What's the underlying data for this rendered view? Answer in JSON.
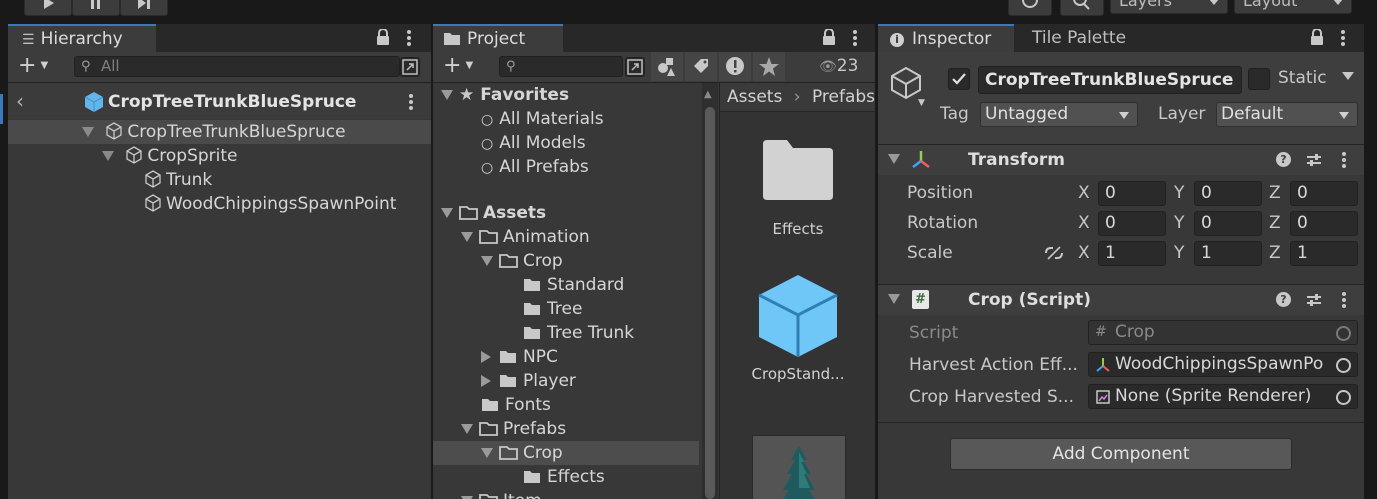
{
  "toolbar": {
    "layers_label": "Layers",
    "layout_label": "Layout"
  },
  "hierarchy": {
    "tab_label": "Hierarchy",
    "search_placeholder": "All",
    "prefab_title": "CropTreeTrunkBlueSpruce",
    "items": [
      {
        "label": "CropTreeTrunkBlueSpruce"
      },
      {
        "label": "CropSprite"
      },
      {
        "label": "Trunk"
      },
      {
        "label": "WoodChippingsSpawnPoint"
      }
    ]
  },
  "project": {
    "tab_label": "Project",
    "hidden_count": "23",
    "breadcrumb": [
      "Assets",
      "Prefabs"
    ],
    "favorites_label": "Favorites",
    "favorites": [
      "All Materials",
      "All Models",
      "All Prefabs"
    ],
    "assets_label": "Assets",
    "tree": [
      {
        "label": "Animation"
      },
      {
        "label": "Crop"
      },
      {
        "label": "Standard"
      },
      {
        "label": "Tree"
      },
      {
        "label": "Tree Trunk"
      },
      {
        "label": "NPC"
      },
      {
        "label": "Player"
      },
      {
        "label": "Fonts"
      },
      {
        "label": "Prefabs"
      },
      {
        "label": "Crop"
      },
      {
        "label": "Effects"
      },
      {
        "label": "Item"
      }
    ],
    "grid_items": [
      {
        "label": "Effects",
        "icon": "folder-icon"
      },
      {
        "label": "CropStand...",
        "icon": "prefab-cube-icon"
      },
      {
        "label": "",
        "icon": "tree-sprite-thumbnail"
      }
    ]
  },
  "inspector": {
    "tab_label": "Inspector",
    "tab2_label": "Tile Palette",
    "object_name": "CropTreeTrunkBlueSpruce",
    "active": true,
    "static_label": "Static",
    "tag_label": "Tag",
    "tag_value": "Untagged",
    "layer_label": "Layer",
    "layer_value": "Default",
    "transform": {
      "title": "Transform",
      "rows": [
        {
          "label": "Position",
          "x": "0",
          "y": "0",
          "z": "0"
        },
        {
          "label": "Rotation",
          "x": "0",
          "y": "0",
          "z": "0"
        },
        {
          "label": "Scale",
          "x": "1",
          "y": "1",
          "z": "1"
        }
      ],
      "axis_x": "X",
      "axis_y": "Y",
      "axis_z": "Z"
    },
    "script_component": {
      "title": "Crop (Script)",
      "rows": [
        {
          "label": "Script",
          "value": "Crop"
        },
        {
          "label": "Harvest Action Eff...",
          "value": "WoodChippingsSpawnPo"
        },
        {
          "label": "Crop Harvested S...",
          "value": "None (Sprite Renderer)"
        }
      ]
    },
    "add_component_label": "Add Component"
  }
}
